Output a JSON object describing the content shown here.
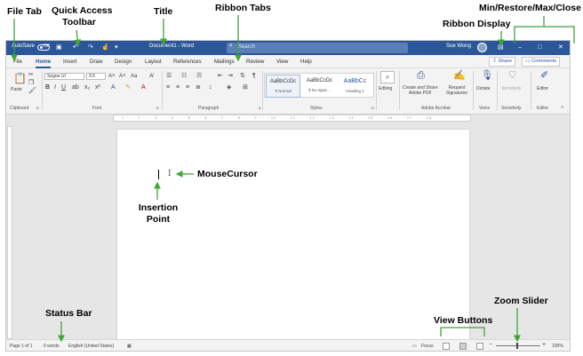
{
  "callouts": {
    "file_tab": "File Tab",
    "quick_access_line1": "Quick Access",
    "quick_access_line2": "Toolbar",
    "title": "Title",
    "ribbon_tabs": "Ribbon Tabs",
    "ribbon_display": "Ribbon Display",
    "min_restore": "Min/Restore/Max/Close",
    "mouse_cursor": "MouseCursor",
    "insertion_line1": "Insertion",
    "insertion_line2": "Point",
    "status_bar": "Status Bar",
    "view_buttons": "View Buttons",
    "zoom_slider": "Zoom Slider"
  },
  "titlebar": {
    "autosave_label": "AutoSave",
    "autosave_state": "Off",
    "doc_title": "Document1 - Word",
    "search_placeholder": "Search",
    "user_name": "Sue Wong",
    "window_controls": [
      "–",
      "□",
      "✕"
    ]
  },
  "tabs": [
    "File",
    "Home",
    "Insert",
    "Draw",
    "Design",
    "Layout",
    "References",
    "Mailings",
    "Review",
    "View",
    "Help"
  ],
  "active_tab": "Home",
  "share_label": "Share",
  "comments_label": "Comments",
  "ribbon": {
    "clipboard": {
      "paste": "Paste",
      "group": "Clipboard"
    },
    "font": {
      "family": "Segoe UI",
      "size": "9.5",
      "group": "Font"
    },
    "paragraph": {
      "group": "Paragraph"
    },
    "styles": {
      "group": "Styles",
      "items": [
        {
          "sample": "AaBbCcDc",
          "name": "¶ Normal"
        },
        {
          "sample": "AaBbCcDc",
          "name": "¶ No Spac..."
        },
        {
          "sample": "AaBbCc",
          "name": "Heading 1"
        }
      ]
    },
    "editing": {
      "label": "Editing"
    },
    "acrobat": {
      "create_pdf_line1": "Create and Share",
      "create_pdf_line2": "Adobe PDF",
      "request_line1": "Request",
      "request_line2": "Signatures",
      "group": "Adobe Acrobat"
    },
    "voice": {
      "dictate": "Dictate",
      "group": "Voice"
    },
    "sensitivity": {
      "label": "Sensitivity",
      "group": "Sensitivity"
    },
    "editor": {
      "label": "Editor",
      "group": "Editor"
    }
  },
  "status": {
    "page": "Page 1 of 1",
    "words": "0 words",
    "language": "English (United States)",
    "focus": "Focus",
    "zoom": "100%"
  },
  "colors": {
    "accent": "#2b579a",
    "arrow": "#3fa535"
  }
}
